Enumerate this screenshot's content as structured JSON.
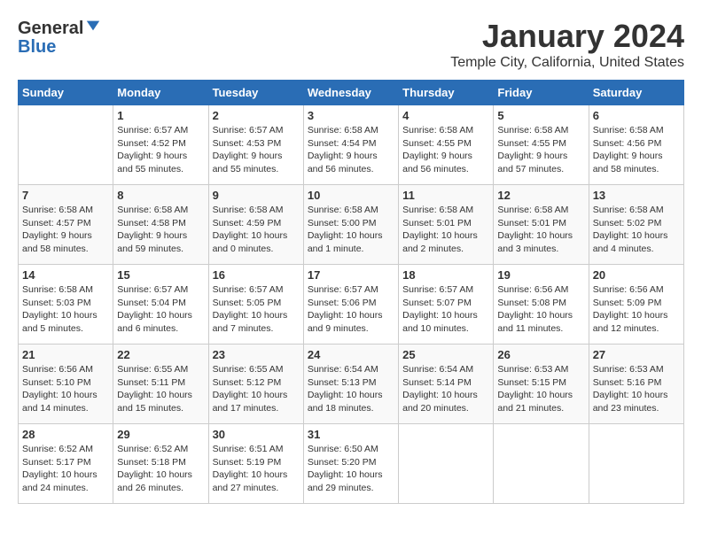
{
  "logo": {
    "general": "General",
    "blue": "Blue"
  },
  "title": "January 2024",
  "subtitle": "Temple City, California, United States",
  "days_of_week": [
    "Sunday",
    "Monday",
    "Tuesday",
    "Wednesday",
    "Thursday",
    "Friday",
    "Saturday"
  ],
  "weeks": [
    [
      {
        "day": "",
        "sunrise": "",
        "sunset": "",
        "daylight": ""
      },
      {
        "day": "1",
        "sunrise": "Sunrise: 6:57 AM",
        "sunset": "Sunset: 4:52 PM",
        "daylight": "Daylight: 9 hours and 55 minutes."
      },
      {
        "day": "2",
        "sunrise": "Sunrise: 6:57 AM",
        "sunset": "Sunset: 4:53 PM",
        "daylight": "Daylight: 9 hours and 55 minutes."
      },
      {
        "day": "3",
        "sunrise": "Sunrise: 6:58 AM",
        "sunset": "Sunset: 4:54 PM",
        "daylight": "Daylight: 9 hours and 56 minutes."
      },
      {
        "day": "4",
        "sunrise": "Sunrise: 6:58 AM",
        "sunset": "Sunset: 4:55 PM",
        "daylight": "Daylight: 9 hours and 56 minutes."
      },
      {
        "day": "5",
        "sunrise": "Sunrise: 6:58 AM",
        "sunset": "Sunset: 4:55 PM",
        "daylight": "Daylight: 9 hours and 57 minutes."
      },
      {
        "day": "6",
        "sunrise": "Sunrise: 6:58 AM",
        "sunset": "Sunset: 4:56 PM",
        "daylight": "Daylight: 9 hours and 58 minutes."
      }
    ],
    [
      {
        "day": "7",
        "sunrise": "Sunrise: 6:58 AM",
        "sunset": "Sunset: 4:57 PM",
        "daylight": "Daylight: 9 hours and 58 minutes."
      },
      {
        "day": "8",
        "sunrise": "Sunrise: 6:58 AM",
        "sunset": "Sunset: 4:58 PM",
        "daylight": "Daylight: 9 hours and 59 minutes."
      },
      {
        "day": "9",
        "sunrise": "Sunrise: 6:58 AM",
        "sunset": "Sunset: 4:59 PM",
        "daylight": "Daylight: 10 hours and 0 minutes."
      },
      {
        "day": "10",
        "sunrise": "Sunrise: 6:58 AM",
        "sunset": "Sunset: 5:00 PM",
        "daylight": "Daylight: 10 hours and 1 minute."
      },
      {
        "day": "11",
        "sunrise": "Sunrise: 6:58 AM",
        "sunset": "Sunset: 5:01 PM",
        "daylight": "Daylight: 10 hours and 2 minutes."
      },
      {
        "day": "12",
        "sunrise": "Sunrise: 6:58 AM",
        "sunset": "Sunset: 5:01 PM",
        "daylight": "Daylight: 10 hours and 3 minutes."
      },
      {
        "day": "13",
        "sunrise": "Sunrise: 6:58 AM",
        "sunset": "Sunset: 5:02 PM",
        "daylight": "Daylight: 10 hours and 4 minutes."
      }
    ],
    [
      {
        "day": "14",
        "sunrise": "Sunrise: 6:58 AM",
        "sunset": "Sunset: 5:03 PM",
        "daylight": "Daylight: 10 hours and 5 minutes."
      },
      {
        "day": "15",
        "sunrise": "Sunrise: 6:57 AM",
        "sunset": "Sunset: 5:04 PM",
        "daylight": "Daylight: 10 hours and 6 minutes."
      },
      {
        "day": "16",
        "sunrise": "Sunrise: 6:57 AM",
        "sunset": "Sunset: 5:05 PM",
        "daylight": "Daylight: 10 hours and 7 minutes."
      },
      {
        "day": "17",
        "sunrise": "Sunrise: 6:57 AM",
        "sunset": "Sunset: 5:06 PM",
        "daylight": "Daylight: 10 hours and 9 minutes."
      },
      {
        "day": "18",
        "sunrise": "Sunrise: 6:57 AM",
        "sunset": "Sunset: 5:07 PM",
        "daylight": "Daylight: 10 hours and 10 minutes."
      },
      {
        "day": "19",
        "sunrise": "Sunrise: 6:56 AM",
        "sunset": "Sunset: 5:08 PM",
        "daylight": "Daylight: 10 hours and 11 minutes."
      },
      {
        "day": "20",
        "sunrise": "Sunrise: 6:56 AM",
        "sunset": "Sunset: 5:09 PM",
        "daylight": "Daylight: 10 hours and 12 minutes."
      }
    ],
    [
      {
        "day": "21",
        "sunrise": "Sunrise: 6:56 AM",
        "sunset": "Sunset: 5:10 PM",
        "daylight": "Daylight: 10 hours and 14 minutes."
      },
      {
        "day": "22",
        "sunrise": "Sunrise: 6:55 AM",
        "sunset": "Sunset: 5:11 PM",
        "daylight": "Daylight: 10 hours and 15 minutes."
      },
      {
        "day": "23",
        "sunrise": "Sunrise: 6:55 AM",
        "sunset": "Sunset: 5:12 PM",
        "daylight": "Daylight: 10 hours and 17 minutes."
      },
      {
        "day": "24",
        "sunrise": "Sunrise: 6:54 AM",
        "sunset": "Sunset: 5:13 PM",
        "daylight": "Daylight: 10 hours and 18 minutes."
      },
      {
        "day": "25",
        "sunrise": "Sunrise: 6:54 AM",
        "sunset": "Sunset: 5:14 PM",
        "daylight": "Daylight: 10 hours and 20 minutes."
      },
      {
        "day": "26",
        "sunrise": "Sunrise: 6:53 AM",
        "sunset": "Sunset: 5:15 PM",
        "daylight": "Daylight: 10 hours and 21 minutes."
      },
      {
        "day": "27",
        "sunrise": "Sunrise: 6:53 AM",
        "sunset": "Sunset: 5:16 PM",
        "daylight": "Daylight: 10 hours and 23 minutes."
      }
    ],
    [
      {
        "day": "28",
        "sunrise": "Sunrise: 6:52 AM",
        "sunset": "Sunset: 5:17 PM",
        "daylight": "Daylight: 10 hours and 24 minutes."
      },
      {
        "day": "29",
        "sunrise": "Sunrise: 6:52 AM",
        "sunset": "Sunset: 5:18 PM",
        "daylight": "Daylight: 10 hours and 26 minutes."
      },
      {
        "day": "30",
        "sunrise": "Sunrise: 6:51 AM",
        "sunset": "Sunset: 5:19 PM",
        "daylight": "Daylight: 10 hours and 27 minutes."
      },
      {
        "day": "31",
        "sunrise": "Sunrise: 6:50 AM",
        "sunset": "Sunset: 5:20 PM",
        "daylight": "Daylight: 10 hours and 29 minutes."
      },
      {
        "day": "",
        "sunrise": "",
        "sunset": "",
        "daylight": ""
      },
      {
        "day": "",
        "sunrise": "",
        "sunset": "",
        "daylight": ""
      },
      {
        "day": "",
        "sunrise": "",
        "sunset": "",
        "daylight": ""
      }
    ]
  ]
}
